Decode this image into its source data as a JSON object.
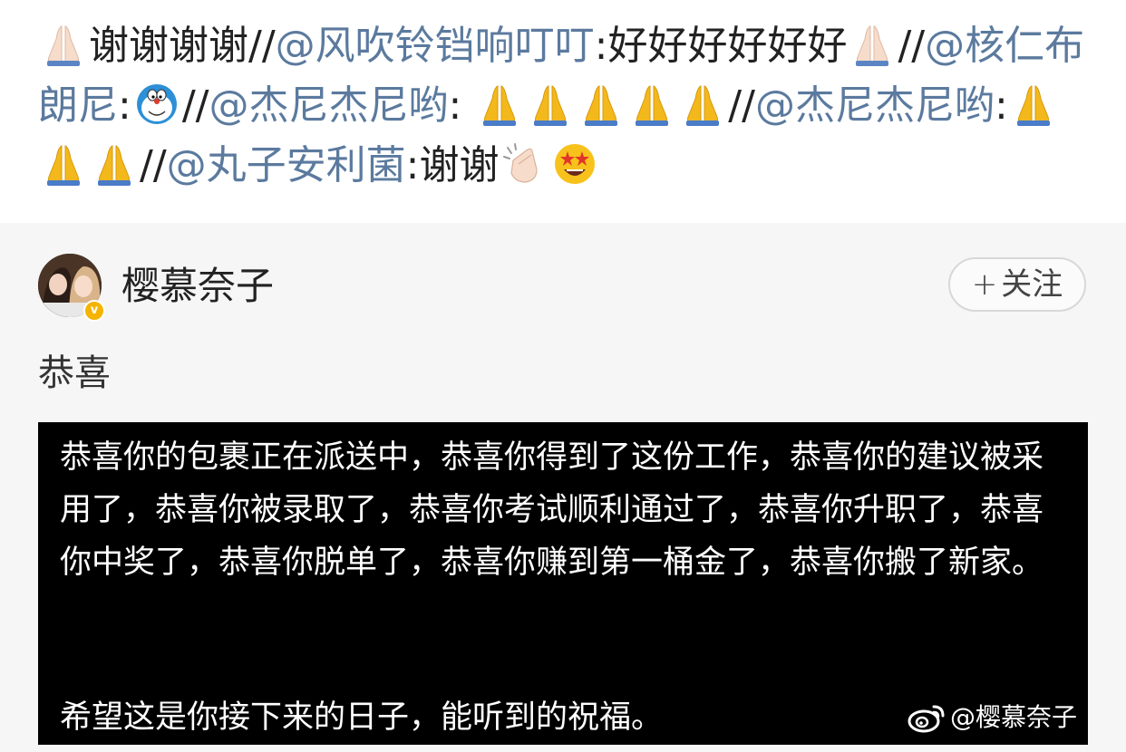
{
  "repost_chain": [
    {
      "kind": "emoji",
      "icon": "pray-light-icon"
    },
    {
      "kind": "text",
      "text": "谢谢谢谢//"
    },
    {
      "kind": "mention",
      "text": "@风吹铃铛响叮叮"
    },
    {
      "kind": "text",
      "text": ":好好好好好好"
    },
    {
      "kind": "emoji",
      "icon": "pray-light-icon"
    },
    {
      "kind": "text",
      "text": "//"
    },
    {
      "kind": "mention",
      "text": "@核仁布朗尼"
    },
    {
      "kind": "text",
      "text": ":"
    },
    {
      "kind": "emoji",
      "icon": "doraemon-icon"
    },
    {
      "kind": "text",
      "text": "//"
    },
    {
      "kind": "mention",
      "text": "@杰尼杰尼哟"
    },
    {
      "kind": "text",
      "text": ": "
    },
    {
      "kind": "emoji",
      "icon": "pray-yellow-icon"
    },
    {
      "kind": "emoji",
      "icon": "pray-yellow-icon"
    },
    {
      "kind": "emoji",
      "icon": "pray-yellow-icon"
    },
    {
      "kind": "emoji",
      "icon": "pray-yellow-icon"
    },
    {
      "kind": "emoji",
      "icon": "pray-yellow-icon"
    },
    {
      "kind": "text",
      "text": "//"
    },
    {
      "kind": "mention",
      "text": "@杰尼杰尼哟"
    },
    {
      "kind": "text",
      "text": ":"
    },
    {
      "kind": "emoji",
      "icon": "pray-yellow-icon"
    },
    {
      "kind": "emoji",
      "icon": "pray-yellow-icon"
    },
    {
      "kind": "emoji",
      "icon": "pray-yellow-icon"
    },
    {
      "kind": "text",
      "text": "//"
    },
    {
      "kind": "mention",
      "text": "@丸子安利菌"
    },
    {
      "kind": "text",
      "text": ":谢谢"
    },
    {
      "kind": "emoji",
      "icon": "clapping-icon"
    },
    {
      "kind": "emoji",
      "icon": "star-struck-icon"
    }
  ],
  "original_post": {
    "username": "樱慕奈子",
    "follow_label": "关注",
    "follow_plus": "+",
    "text": "恭喜",
    "image_paragraph": "恭喜你的包裹正在派送中，恭喜你得到了这份工作，恭喜你的建议被采用了，恭喜你被录取了，恭喜你考试顺利通过了，恭喜你升职了，恭喜你中奖了，恭喜你脱单了，恭喜你赚到第一桶金了，恭喜你搬了新家。",
    "image_closing": "希望这是你接下来的日子，能听到的祝福。",
    "watermark": "@樱慕奈子"
  },
  "colors": {
    "mention": "#5b7a9e",
    "text": "#222222",
    "card_bg": "#f6f6f6",
    "image_bg": "#000000"
  }
}
